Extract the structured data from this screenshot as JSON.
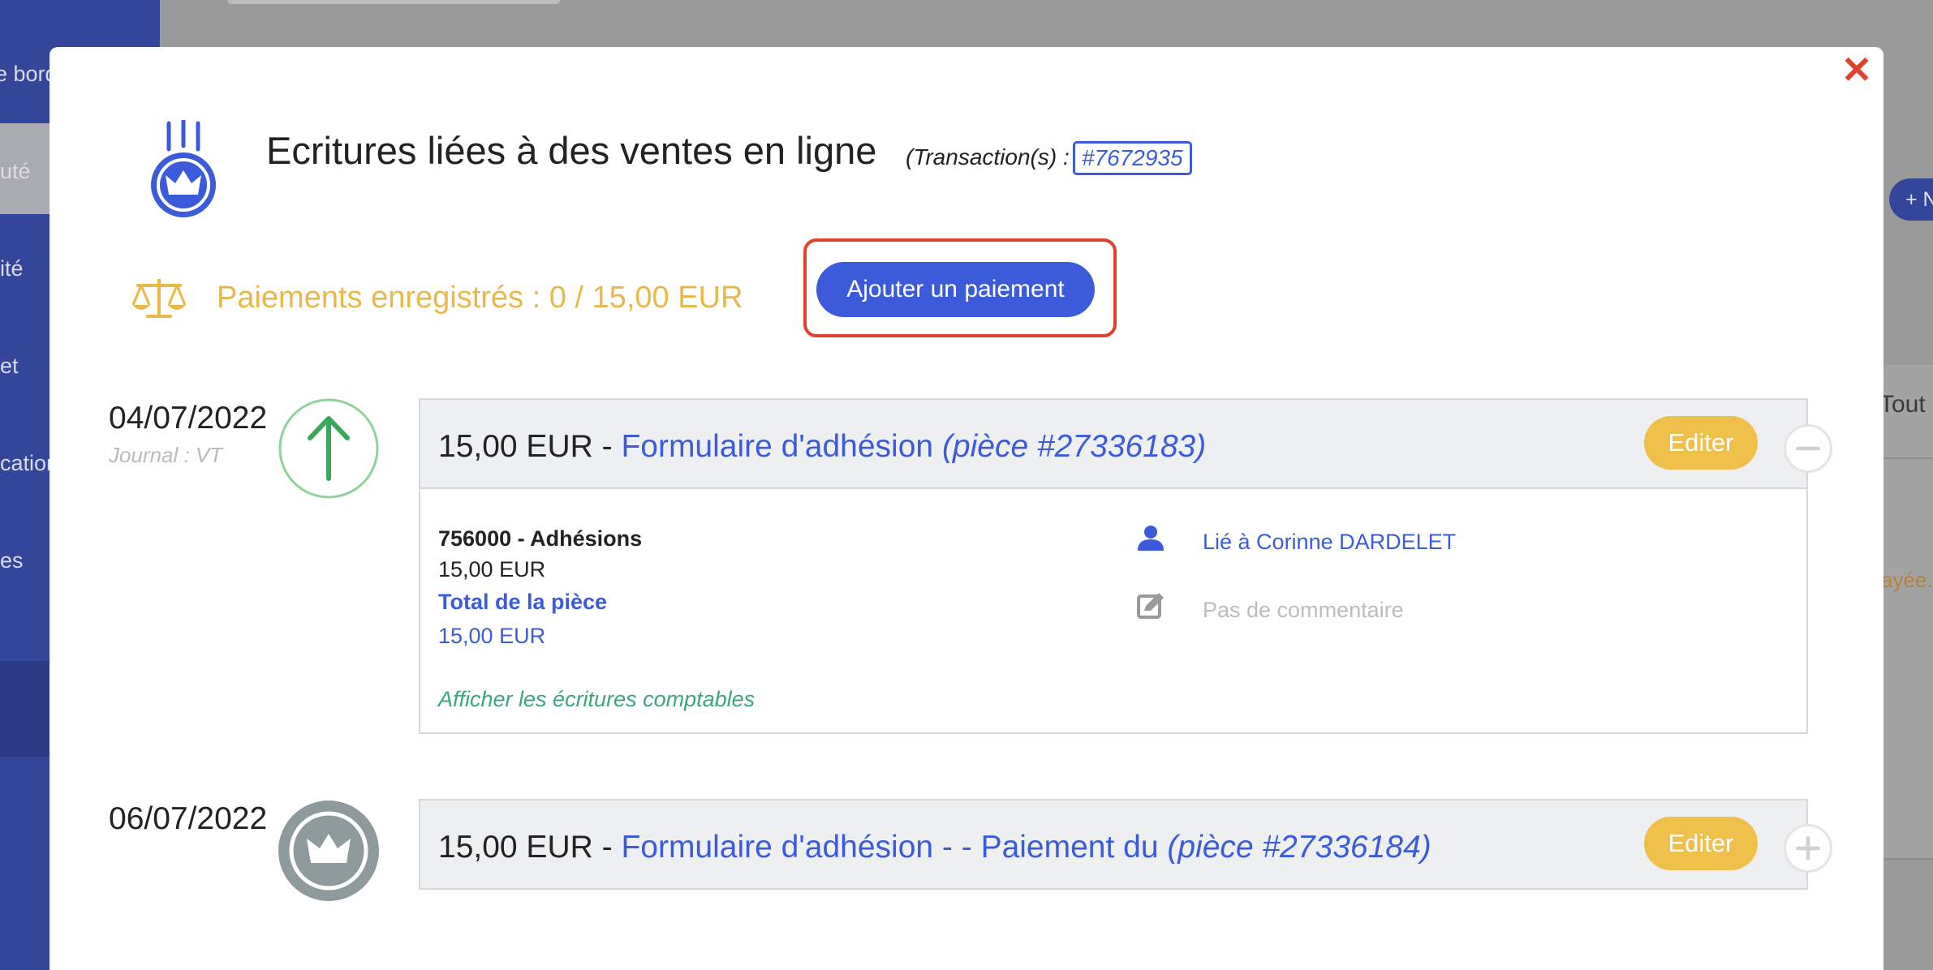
{
  "background": {
    "nav_items": [
      "e bord",
      "uté",
      "ité",
      "et",
      "cation",
      "es"
    ],
    "right_button": "+ N",
    "right_text_1": "Tout",
    "right_text_2": "ayée."
  },
  "modal": {
    "title": "Ecritures liées à des ventes en ligne",
    "transaction_label": "(Transaction(s) :",
    "transaction_link": "#7672935",
    "payments_text": "Paiements enregistrés : 0 / 15,00 EUR",
    "add_payment_label": "Ajouter un paiement",
    "close_label": "✕"
  },
  "entries": [
    {
      "date": "04/07/2022",
      "journal": "Journal : VT",
      "amount": "15,00 EUR - ",
      "form_name": "Formulaire d'adhésion",
      "piece": "(pièce #27336183)",
      "edit_label": "Editer",
      "account": "756000 - Adhésions",
      "account_amount": "15,00 EUR",
      "total_label": "Total de la pièce",
      "total_amount": "15,00 EUR",
      "show_entries_label": "Afficher les écritures comptables",
      "linked_to": "Lié à Corinne DARDELET",
      "comment": "Pas de commentaire"
    },
    {
      "date": "06/07/2022",
      "amount": "15,00 EUR - ",
      "form_name": "Formulaire d'adhésion - - Paiement du",
      "piece": "(pièce #27336184)",
      "edit_label": "Editer"
    }
  ],
  "colors": {
    "primary_blue": "#3b5bdb",
    "edit_yellow": "#eec04a",
    "payments_yellow": "#e8b94a",
    "highlight_red": "#e0412a",
    "arrow_green": "#3aa85a"
  }
}
